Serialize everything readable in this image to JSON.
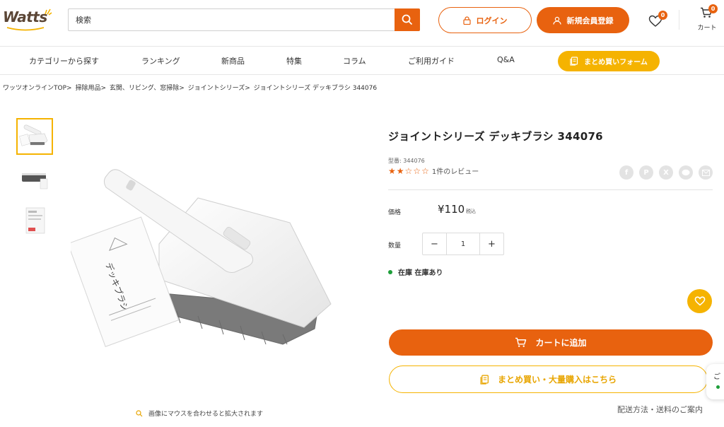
{
  "header": {
    "logo_text": "Watts",
    "search_placeholder": "検索",
    "login_label": "ログイン",
    "register_label": "新規会員登録",
    "favorites_count": "0",
    "cart_count": "0",
    "cart_label": "カート"
  },
  "nav": {
    "items": [
      "カテゴリーから探す",
      "ランキング",
      "新商品",
      "特集",
      "コラム",
      "ご利用ガイド",
      "Q&A"
    ],
    "bulk_form_label": "まとめ買いフォーム"
  },
  "breadcrumb": {
    "items": [
      "ワッツオンラインTOP>",
      "掃除用品>",
      "玄関、リビング、窓掃除>",
      "ジョイントシリーズ>",
      "ジョイントシリーズ デッキブラシ 344076"
    ]
  },
  "gallery": {
    "thumbnail_count": 3,
    "active_thumbnail": 1,
    "zoom_hint": "画像にマウスを合わせると拡大されます",
    "package_label": "デッキブラシ"
  },
  "product": {
    "title": "ジョイントシリーズ デッキブラシ 344076",
    "model_number": "型番: 344076",
    "rating": 2,
    "rating_max": 5,
    "review_count_text": "1件のレビュー",
    "share_icons": [
      "facebook-icon",
      "pinterest-icon",
      "x-icon",
      "line-icon",
      "mail-icon"
    ],
    "price_label": "価格",
    "price": "¥110",
    "tax_label": "税込",
    "quantity_label": "数量",
    "quantity": "1",
    "stock_text": "在庫 在庫あり",
    "add_to_cart_label": "カートに追加",
    "bulk_purchase_label": "まとめ買い・大量購入はこちら",
    "shipping_link": "配送方法・送料のご案内"
  },
  "side_widget": {
    "text": "ご"
  },
  "colors": {
    "accent_orange": "#e8620f",
    "accent_yellow": "#f5b301",
    "stock_green": "#1e9e3a"
  }
}
